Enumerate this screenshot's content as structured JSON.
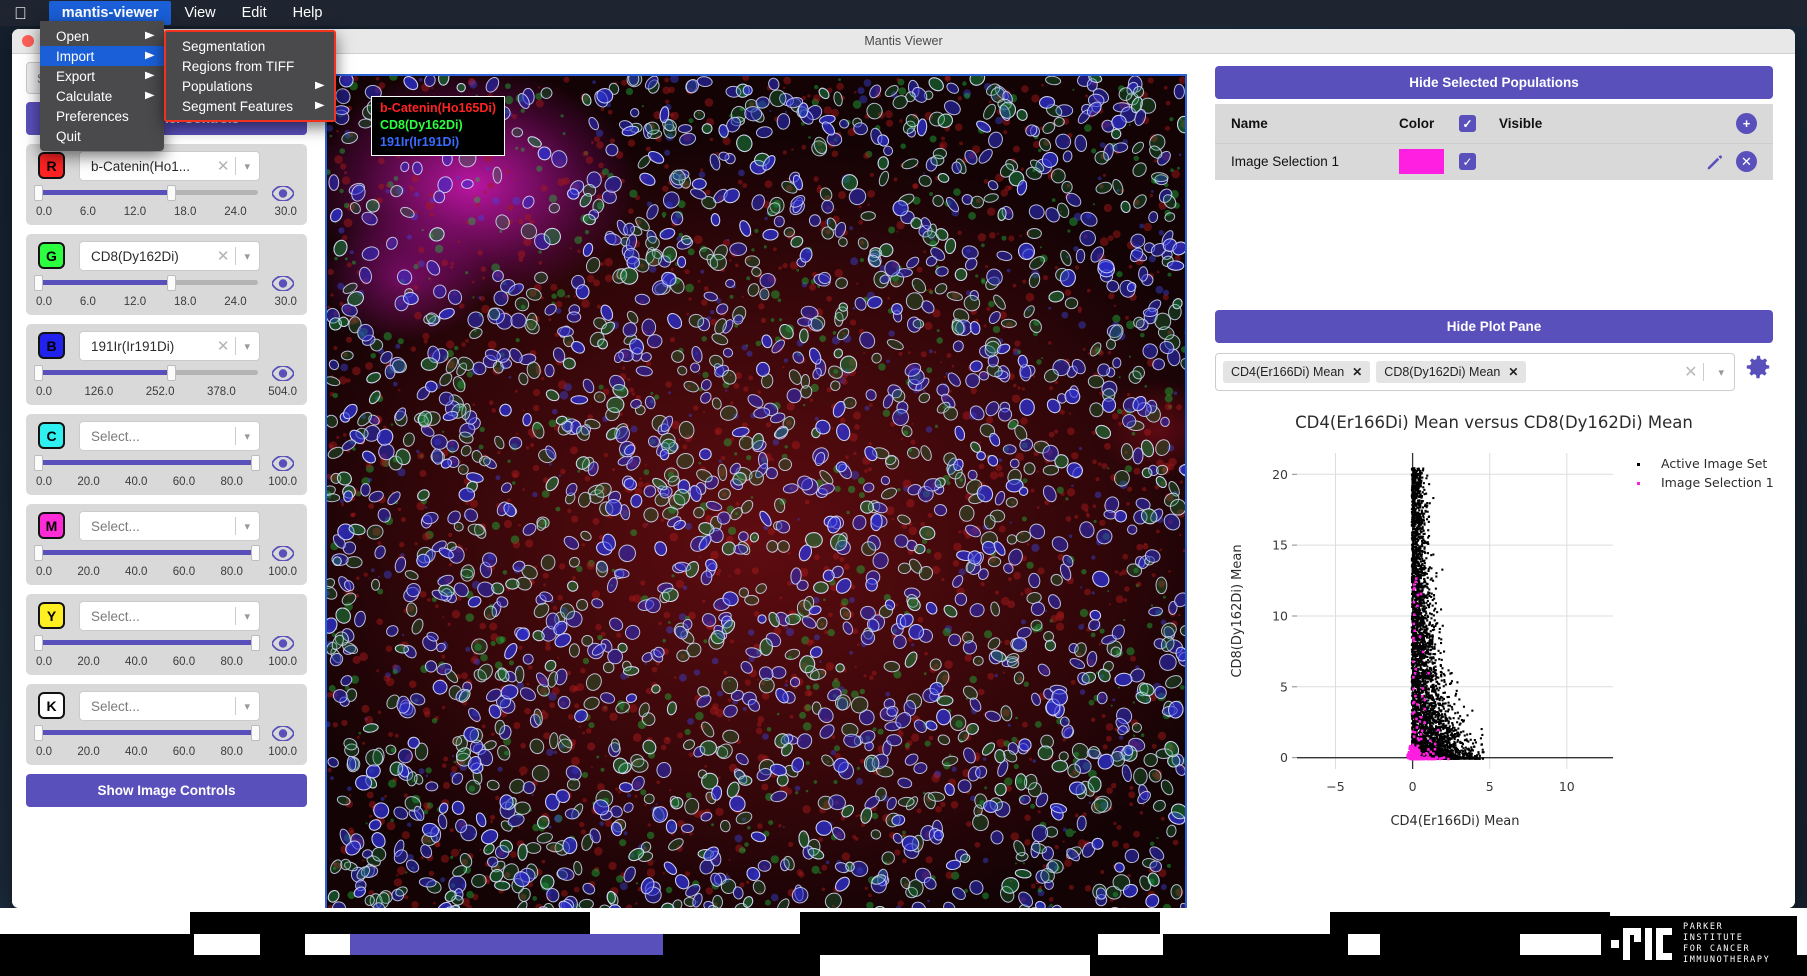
{
  "menubar": {
    "apple_icon": "apple-logo-icon",
    "items": [
      {
        "label": "mantis-viewer",
        "active": true,
        "bold": true
      },
      {
        "label": "View",
        "active": false,
        "bold": false
      },
      {
        "label": "Edit",
        "active": false,
        "bold": false
      },
      {
        "label": "Help",
        "active": false,
        "bold": false
      }
    ]
  },
  "menu_main": {
    "items": [
      {
        "label": "Open",
        "submenu": true,
        "selected": false
      },
      {
        "label": "Import",
        "submenu": true,
        "selected": true
      },
      {
        "label": "Export",
        "submenu": true,
        "selected": false
      },
      {
        "label": "Calculate",
        "submenu": true,
        "selected": false
      },
      {
        "label": "Preferences",
        "submenu": false,
        "selected": false
      },
      {
        "label": "Quit",
        "submenu": false,
        "selected": false
      }
    ]
  },
  "menu_sub": {
    "highlight_color": "#f2321f",
    "items": [
      {
        "label": "Segmentation",
        "submenu": false
      },
      {
        "label": "Regions from TIFF",
        "submenu": false
      },
      {
        "label": "Populations",
        "submenu": true
      },
      {
        "label": "Segment Features",
        "submenu": true
      }
    ]
  },
  "window": {
    "title": "Mantis Viewer"
  },
  "sidebar": {
    "search_placeholder": "S",
    "hide_channel_controls_label": "Hide Channel Controls",
    "show_image_controls_label": "Show Image Controls",
    "channels": [
      {
        "key": "R",
        "color": "#ff2222",
        "value": "b-Catenin(Ho1...",
        "placeholder": "Select...",
        "has_value": true,
        "ticks": [
          "0.0",
          "6.0",
          "12.0",
          "18.0",
          "24.0",
          "30.0"
        ],
        "fill_pct": 63
      },
      {
        "key": "G",
        "color": "#2bff3f",
        "value": "CD8(Dy162Di)",
        "placeholder": "Select...",
        "has_value": true,
        "ticks": [
          "0.0",
          "6.0",
          "12.0",
          "18.0",
          "24.0",
          "30.0"
        ],
        "fill_pct": 63
      },
      {
        "key": "B",
        "color": "#2222ee",
        "value": "191Ir(Ir191Di)",
        "placeholder": "Select...",
        "has_value": true,
        "ticks": [
          "0.0",
          "126.0",
          "252.0",
          "378.0",
          "504.0"
        ],
        "fill_pct": 63
      },
      {
        "key": "C",
        "color": "#2ff0f0",
        "value": "",
        "placeholder": "Select...",
        "has_value": false,
        "ticks": [
          "0.0",
          "20.0",
          "40.0",
          "60.0",
          "80.0",
          "100.0"
        ],
        "fill_pct": 100
      },
      {
        "key": "M",
        "color": "#ff2bd6",
        "value": "",
        "placeholder": "Select...",
        "has_value": false,
        "ticks": [
          "0.0",
          "20.0",
          "40.0",
          "60.0",
          "80.0",
          "100.0"
        ],
        "fill_pct": 100
      },
      {
        "key": "Y",
        "color": "#ffef20",
        "value": "",
        "placeholder": "Select...",
        "has_value": false,
        "ticks": [
          "0.0",
          "20.0",
          "40.0",
          "60.0",
          "80.0",
          "100.0"
        ],
        "fill_pct": 100
      },
      {
        "key": "K",
        "color": "#ffffff",
        "value": "",
        "placeholder": "Select...",
        "has_value": false,
        "ticks": [
          "0.0",
          "20.0",
          "40.0",
          "60.0",
          "80.0",
          "100.0"
        ],
        "fill_pct": 100
      }
    ]
  },
  "viewer": {
    "overlay_legend": [
      {
        "text": "b-Catenin(Ho165Di)",
        "color": "#ff2222"
      },
      {
        "text": "CD8(Dy162Di)",
        "color": "#2bff3f"
      },
      {
        "text": "191Ir(Ir191Di)",
        "color": "#3a6bff"
      }
    ]
  },
  "populations": {
    "hide_button_label": "Hide Selected Populations",
    "columns": {
      "name": "Name",
      "color": "Color",
      "visible": "Visible"
    },
    "header_checkbox_checked": true,
    "add_icon": "plus-icon",
    "rows": [
      {
        "name": "Image Selection 1",
        "color": "#ff1fe0",
        "visible": true,
        "edit_icon": "pencil-icon",
        "delete_icon": "close-circle-icon"
      }
    ]
  },
  "plot_pane": {
    "hide_button_label": "Hide Plot Pane",
    "tags": [
      "CD4(Er166Di) Mean",
      "CD8(Dy162Di) Mean"
    ],
    "clear_icon": "close-icon",
    "dropdown_icon": "chevron-down-icon",
    "settings_icon": "gear-icon"
  },
  "chart_data": {
    "type": "scatter",
    "title": "CD4(Er166Di) Mean versus CD8(Dy162Di) Mean",
    "xlabel": "CD4(Er166Di) Mean",
    "ylabel": "CD8(Dy162Di) Mean",
    "xlim": [
      -7.5,
      13.0
    ],
    "ylim": [
      -0.8,
      21.5
    ],
    "xticks": [
      -5,
      0,
      5,
      10
    ],
    "yticks": [
      0,
      5,
      10,
      15,
      20
    ],
    "grid": true,
    "legend_position": "right",
    "series": [
      {
        "name": "Active Image Set",
        "color": "#000000",
        "marker": "square",
        "n_points": 4200,
        "description": "Dense vertical cluster at x near 0 (range -0.3 to 3.5), y from 0 to 20, heaviest near origin"
      },
      {
        "name": "Image Selection 1",
        "color": "#ff1fe0",
        "marker": "square",
        "n_points": 120,
        "description": "Magenta subset concentrated at the origin with scattered points up to y=13"
      }
    ]
  },
  "footer": {
    "logo": {
      "name": "pici-logo",
      "lines": [
        "PARKER",
        "INSTITUTE",
        "FOR CANCER",
        "IMMUNOTHERAPY"
      ]
    }
  }
}
